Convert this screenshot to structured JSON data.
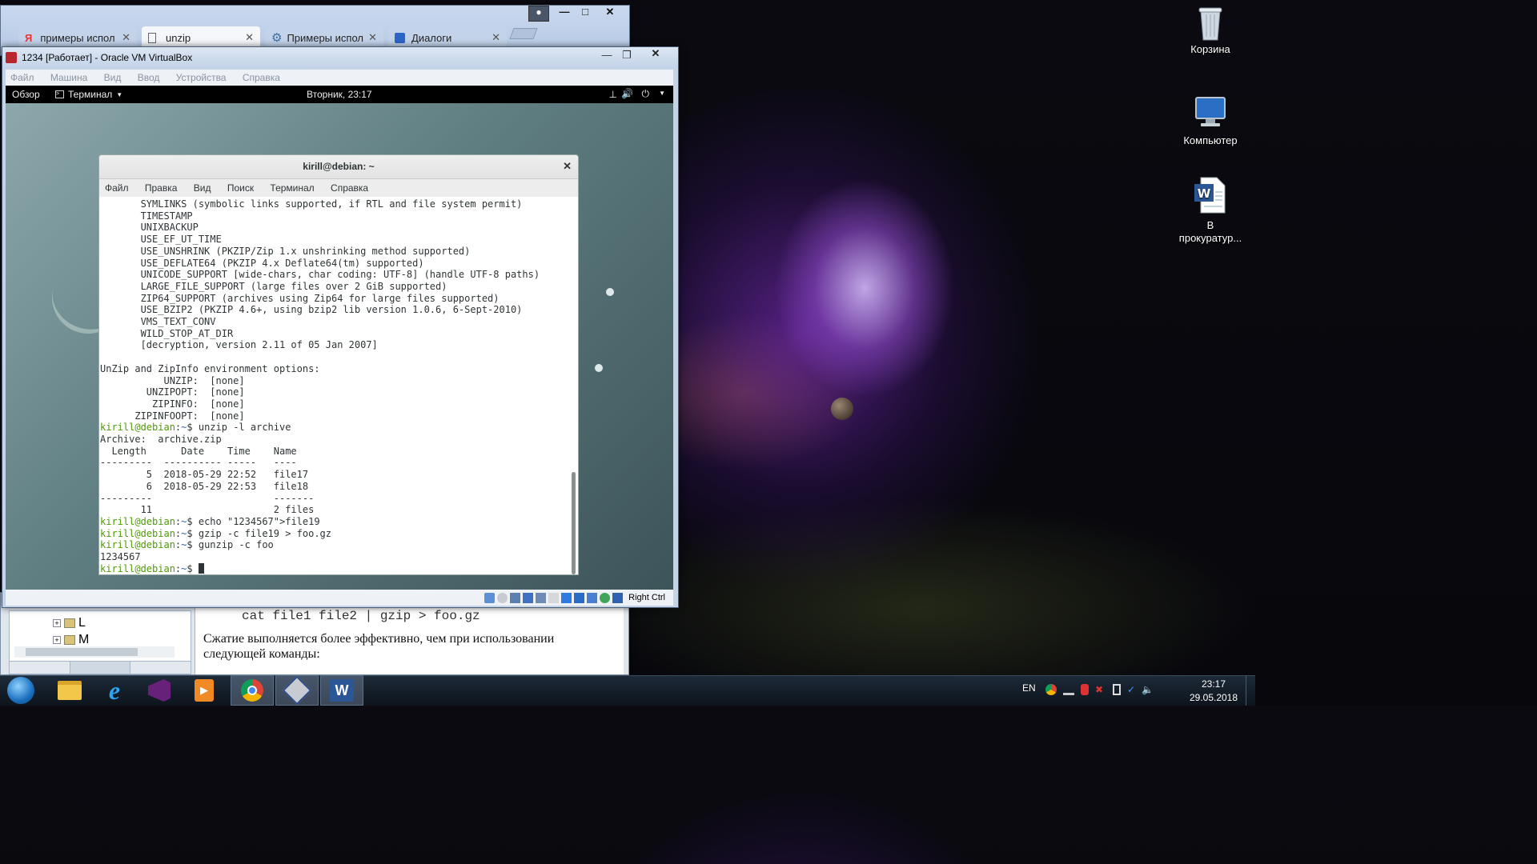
{
  "desktop": {
    "icons": [
      {
        "name": "recycle-bin",
        "label": "Корзина"
      },
      {
        "name": "computer",
        "label": "Компьютер"
      },
      {
        "name": "word-document",
        "label": "В прокуратур..."
      }
    ]
  },
  "browser": {
    "tabs": [
      {
        "label": "примеры испол",
        "icon": "yandex-icon"
      },
      {
        "label": "unzip",
        "icon": "page-icon"
      },
      {
        "label": "Примеры испол",
        "icon": "gear-icon"
      },
      {
        "label": "Диалоги",
        "icon": "dialog-icon"
      }
    ]
  },
  "vbox": {
    "title": "1234 [Работает] - Oracle VM VirtualBox",
    "menu": [
      "Файл",
      "Машина",
      "Вид",
      "Ввод",
      "Устройства",
      "Справка"
    ],
    "host_key": "Right Ctrl"
  },
  "gnome": {
    "activities": "Обзор",
    "app_menu": "Терминал",
    "clock": "Вторник, 23:17"
  },
  "terminal": {
    "title": "kirill@debian: ~",
    "menu": [
      "Файл",
      "Правка",
      "Вид",
      "Поиск",
      "Терминал",
      "Справка"
    ],
    "prompt_user": "kirill@debian",
    "prompt_path": "~",
    "lines": [
      {
        "t": "       SYMLINKS (symbolic links supported, if RTL and file system permit)"
      },
      {
        "t": "       TIMESTAMP"
      },
      {
        "t": "       UNIXBACKUP"
      },
      {
        "t": "       USE_EF_UT_TIME"
      },
      {
        "t": "       USE_UNSHRINK (PKZIP/Zip 1.x unshrinking method supported)"
      },
      {
        "t": "       USE_DEFLATE64 (PKZIP 4.x Deflate64(tm) supported)"
      },
      {
        "t": "       UNICODE_SUPPORT [wide-chars, char coding: UTF-8] (handle UTF-8 paths)"
      },
      {
        "t": "       LARGE_FILE_SUPPORT (large files over 2 GiB supported)"
      },
      {
        "t": "       ZIP64_SUPPORT (archives using Zip64 for large files supported)"
      },
      {
        "t": "       USE_BZIP2 (PKZIP 4.6+, using bzip2 lib version 1.0.6, 6-Sept-2010)"
      },
      {
        "t": "       VMS_TEXT_CONV"
      },
      {
        "t": "       WILD_STOP_AT_DIR"
      },
      {
        "t": "       [decryption, version 2.11 of 05 Jan 2007]"
      },
      {
        "t": ""
      },
      {
        "t": "UnZip and ZipInfo environment options:"
      },
      {
        "t": "           UNZIP:  [none]"
      },
      {
        "t": "        UNZIPOPT:  [none]"
      },
      {
        "t": "         ZIPINFO:  [none]"
      },
      {
        "t": "      ZIPINFOOPT:  [none]"
      },
      {
        "p": true,
        "t": "unzip -l archive"
      },
      {
        "t": "Archive:  archive.zip"
      },
      {
        "t": "  Length      Date    Time    Name"
      },
      {
        "t": "---------  ---------- -----   ----"
      },
      {
        "t": "        5  2018-05-29 22:52   file17"
      },
      {
        "t": "        6  2018-05-29 22:53   file18"
      },
      {
        "t": "---------                     -------"
      },
      {
        "t": "       11                     2 files"
      },
      {
        "p": true,
        "t": "echo \"1234567\">file19"
      },
      {
        "p": true,
        "t": "gzip -c file19 > foo.gz"
      },
      {
        "p": true,
        "t": "gunzip -c foo"
      },
      {
        "t": "1234567"
      },
      {
        "p": true,
        "t": "",
        "cursor": true
      }
    ]
  },
  "background_doc": {
    "tree_items": [
      "L",
      "M"
    ],
    "code_line": "cat file1 file2 | gzip > foo.gz",
    "text": "Сжатие выполняется более эффективно, чем при использовании следующей команды:"
  },
  "taskbar": {
    "lang": "EN",
    "time": "23:17",
    "date": "29.05.2018",
    "apps": [
      "explorer-icon",
      "ie-icon",
      "visual-studio-icon",
      "media-player-icon",
      "chrome-icon",
      "virtualbox-icon",
      "word-icon"
    ]
  }
}
